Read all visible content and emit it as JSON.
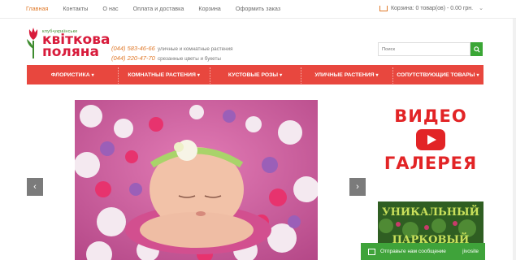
{
  "topnav": {
    "items": [
      "Главная",
      "Контакты",
      "О нас",
      "Оплата и доставка",
      "Корзина",
      "Оформить заказ"
    ],
    "active_index": 0
  },
  "cart": {
    "label": "Корзина: 0 товар(ов) - 0.00 грн."
  },
  "logo": {
    "small": "клуб•українське",
    "line1": "квіткова",
    "line2": "поляна"
  },
  "phones": {
    "phone1": "(044) 583-46-66",
    "phone1_desc": "уличные и комнатные растения",
    "phone2": "(044) 220-47-70",
    "phone2_desc": "срезанные цветы и букеты"
  },
  "search": {
    "placeholder": "Поиск"
  },
  "menu": [
    "ФЛОРИСТИКА",
    "КОМНАТНЫЕ РАСТЕНИЯ",
    "КУСТОВЫЕ РОЗЫ",
    "УЛИЧНЫЕ РАСТЕНИЯ",
    "СОПУТСТВУЮЩИЕ ТОВАРЫ"
  ],
  "video": {
    "line1": "ВИДЕО",
    "line2": "ГАЛЕРЕЯ"
  },
  "banner": {
    "line1": "УНИКАЛЬНЫЙ",
    "line2": "ПАРКОВЫЙ"
  },
  "chat": {
    "label": "Отправьте нам сообщение",
    "brand": "jivosite"
  },
  "colors": {
    "accent_red": "#e8473e",
    "brand_red": "#d81b3b",
    "green": "#3aa635",
    "orange": "#e07a2b"
  }
}
